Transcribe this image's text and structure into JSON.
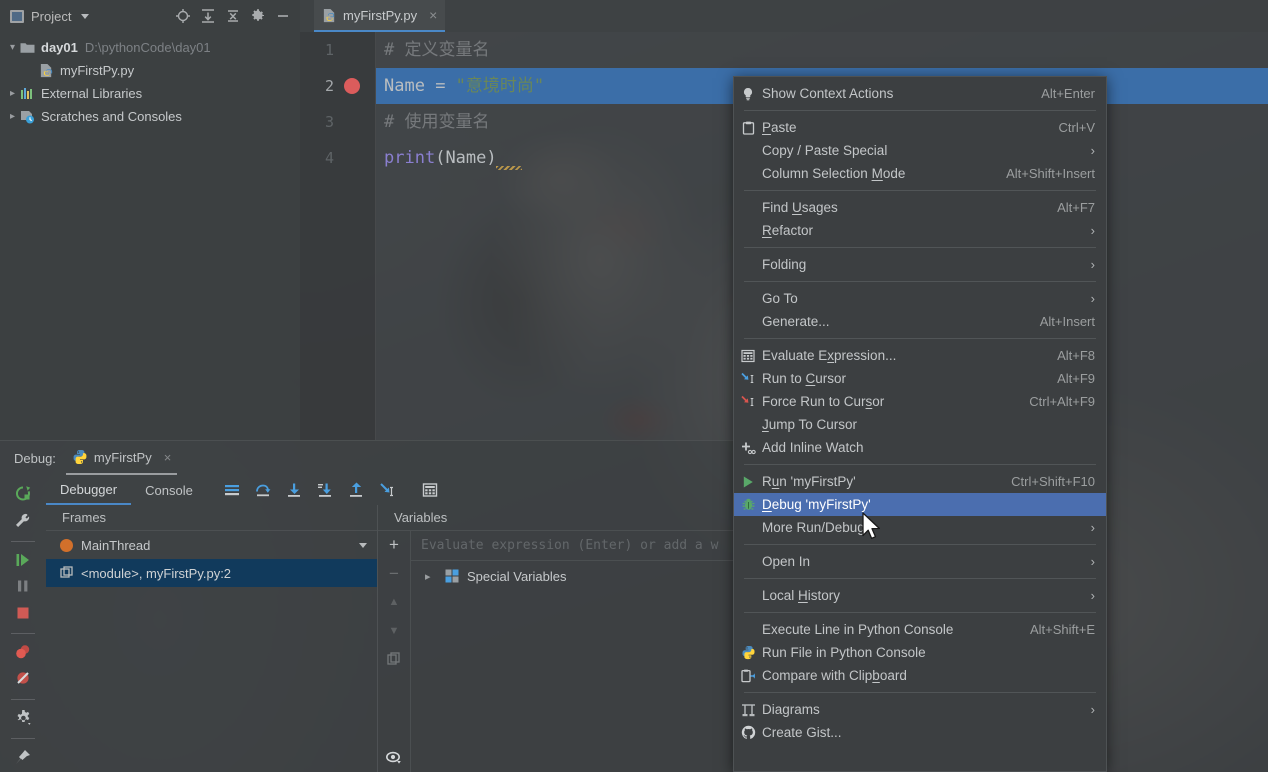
{
  "app": {
    "theme_bg": "#3c3f41",
    "accent": "#4a88c7",
    "menu_selection": "#4b6eaf"
  },
  "project_panel": {
    "title": "Project",
    "icons": [
      "locate-icon",
      "expand-all-icon",
      "collapse-all-icon",
      "gear-icon",
      "minimize-icon"
    ],
    "tree": [
      {
        "label": "day01",
        "sub": "D:\\pythonCode\\day01",
        "icon": "folder-icon",
        "twisty": "expanded",
        "bold": true
      },
      {
        "label": "myFirstPy.py",
        "sub": "",
        "icon": "python-file-icon",
        "twisty": "none",
        "bold": false
      },
      {
        "label": "External Libraries",
        "sub": "",
        "icon": "libraries-icon",
        "twisty": "collapsed",
        "bold": false
      },
      {
        "label": "Scratches and Consoles",
        "sub": "",
        "icon": "scratches-icon",
        "twisty": "collapsed",
        "bold": false
      }
    ]
  },
  "editor": {
    "tab": {
      "label": "myFirstPy.py",
      "icon": "python-file-icon",
      "close": "×"
    },
    "lines": [
      {
        "num": "1",
        "breakpoint": false,
        "selected": false,
        "tokens": [
          {
            "t": "# ",
            "c": "cmt"
          },
          {
            "t": "定义变量名",
            "c": "cmt"
          }
        ]
      },
      {
        "num": "2",
        "breakpoint": true,
        "selected": true,
        "tokens": [
          {
            "t": "Name",
            "c": "var-name"
          },
          {
            "t": " = ",
            "c": "op"
          },
          {
            "t": "\"意境时尚\"",
            "c": "str"
          }
        ]
      },
      {
        "num": "3",
        "breakpoint": false,
        "selected": false,
        "tokens": [
          {
            "t": "# ",
            "c": "cmt"
          },
          {
            "t": "使用变量名",
            "c": "cmt"
          }
        ]
      },
      {
        "num": "4",
        "breakpoint": false,
        "selected": false,
        "tokens": [
          {
            "t": "print",
            "c": "fn"
          },
          {
            "t": "(",
            "c": "paren"
          },
          {
            "t": "Name",
            "c": "var-name"
          },
          {
            "t": ")",
            "c": "paren"
          }
        ]
      }
    ]
  },
  "debug_window": {
    "title": "Debug:",
    "session_tab": {
      "label": "myFirstPy",
      "icon": "python-icon",
      "close": "×"
    },
    "sidebar_buttons": [
      "rerun-icon",
      "settings-wrench-icon",
      "resume-program-icon",
      "pause-program-icon",
      "stop-icon",
      "view-breakpoints-icon",
      "mute-breakpoints-icon",
      "settings-gear-icon",
      "pin-icon"
    ],
    "tabs": [
      {
        "label": "Debugger",
        "active": true
      },
      {
        "label": "Console",
        "active": false
      }
    ],
    "toolbar_icons": [
      "show-execution-point-icon",
      "step-over-icon",
      "step-into-icon",
      "force-step-into-icon",
      "step-out-icon",
      "run-to-cursor-icon",
      "evaluate-expression-icon"
    ],
    "frames": {
      "header": "Frames",
      "thread": {
        "label": "MainThread",
        "state_color": "#d2702b"
      },
      "frame_selected": "<module>, myFirstPy.py:2"
    },
    "variables": {
      "header": "Variables",
      "evaluate_placeholder": "Evaluate expression (Enter) or add a w",
      "add_label": "+",
      "remove_label": "−",
      "items": [
        {
          "label": "Special Variables",
          "icon": "special-variables-icon",
          "twisty": "collapsed"
        }
      ]
    }
  },
  "context_menu": {
    "items": [
      {
        "type": "item",
        "label": "Show Context Actions",
        "key": "Alt+Enter",
        "icon": "lightbulb-icon"
      },
      {
        "type": "sep"
      },
      {
        "type": "item",
        "label": "Paste",
        "key": "Ctrl+V",
        "icon": "clipboard-icon",
        "mnemonic": 0
      },
      {
        "type": "item",
        "label": "Copy / Paste Special",
        "key": "",
        "icon": "",
        "arrow": true
      },
      {
        "type": "item",
        "label": "Column Selection Mode",
        "key": "Alt+Shift+Insert",
        "icon": "",
        "mnemonic": 17
      },
      {
        "type": "sep"
      },
      {
        "type": "item",
        "label": "Find Usages",
        "key": "Alt+F7",
        "icon": "",
        "mnemonic": 5
      },
      {
        "type": "item",
        "label": "Refactor",
        "key": "",
        "icon": "",
        "arrow": true,
        "mnemonic": 0
      },
      {
        "type": "sep"
      },
      {
        "type": "item",
        "label": "Folding",
        "key": "",
        "icon": "",
        "arrow": true
      },
      {
        "type": "sep"
      },
      {
        "type": "item",
        "label": "Go To",
        "key": "",
        "icon": "",
        "arrow": true
      },
      {
        "type": "item",
        "label": "Generate...",
        "key": "Alt+Insert",
        "icon": ""
      },
      {
        "type": "sep"
      },
      {
        "type": "item",
        "label": "Evaluate Expression...",
        "key": "Alt+F8",
        "icon": "evaluate-expression-icon",
        "mnemonic": 10
      },
      {
        "type": "item",
        "label": "Run to Cursor",
        "key": "Alt+F9",
        "icon": "run-to-cursor-icon",
        "mnemonic": 7
      },
      {
        "type": "item",
        "label": "Force Run to Cursor",
        "key": "Ctrl+Alt+F9",
        "icon": "force-run-to-cursor-icon",
        "mnemonic": 16
      },
      {
        "type": "item",
        "label": "Jump To Cursor",
        "key": "",
        "icon": "",
        "mnemonic": 0
      },
      {
        "type": "item",
        "label": "Add Inline Watch",
        "key": "",
        "icon": "add-inline-watch-icon"
      },
      {
        "type": "sep"
      },
      {
        "type": "item",
        "label": "Run 'myFirstPy'",
        "key": "Ctrl+Shift+F10",
        "icon": "run-icon",
        "mnemonic": 1
      },
      {
        "type": "item",
        "label": "Debug 'myFirstPy'",
        "key": "",
        "icon": "debug-bug-icon",
        "selected": true,
        "mnemonic": 0
      },
      {
        "type": "item",
        "label": "More Run/Debug",
        "key": "",
        "icon": "",
        "arrow": true
      },
      {
        "type": "sep"
      },
      {
        "type": "item",
        "label": "Open In",
        "key": "",
        "icon": "",
        "arrow": true
      },
      {
        "type": "sep"
      },
      {
        "type": "item",
        "label": "Local History",
        "key": "",
        "icon": "",
        "arrow": true,
        "mnemonic": 6
      },
      {
        "type": "sep"
      },
      {
        "type": "item",
        "label": "Execute Line in Python Console",
        "key": "Alt+Shift+E",
        "icon": ""
      },
      {
        "type": "item",
        "label": "Run File in Python Console",
        "key": "",
        "icon": "python-icon"
      },
      {
        "type": "item",
        "label": "Compare with Clipboard",
        "key": "",
        "icon": "compare-clipboard-icon",
        "mnemonic": 17
      },
      {
        "type": "sep"
      },
      {
        "type": "item",
        "label": "Diagrams",
        "key": "",
        "icon": "diagrams-icon",
        "arrow": true
      },
      {
        "type": "item",
        "label": "Create Gist...",
        "key": "",
        "icon": "github-icon"
      }
    ]
  }
}
